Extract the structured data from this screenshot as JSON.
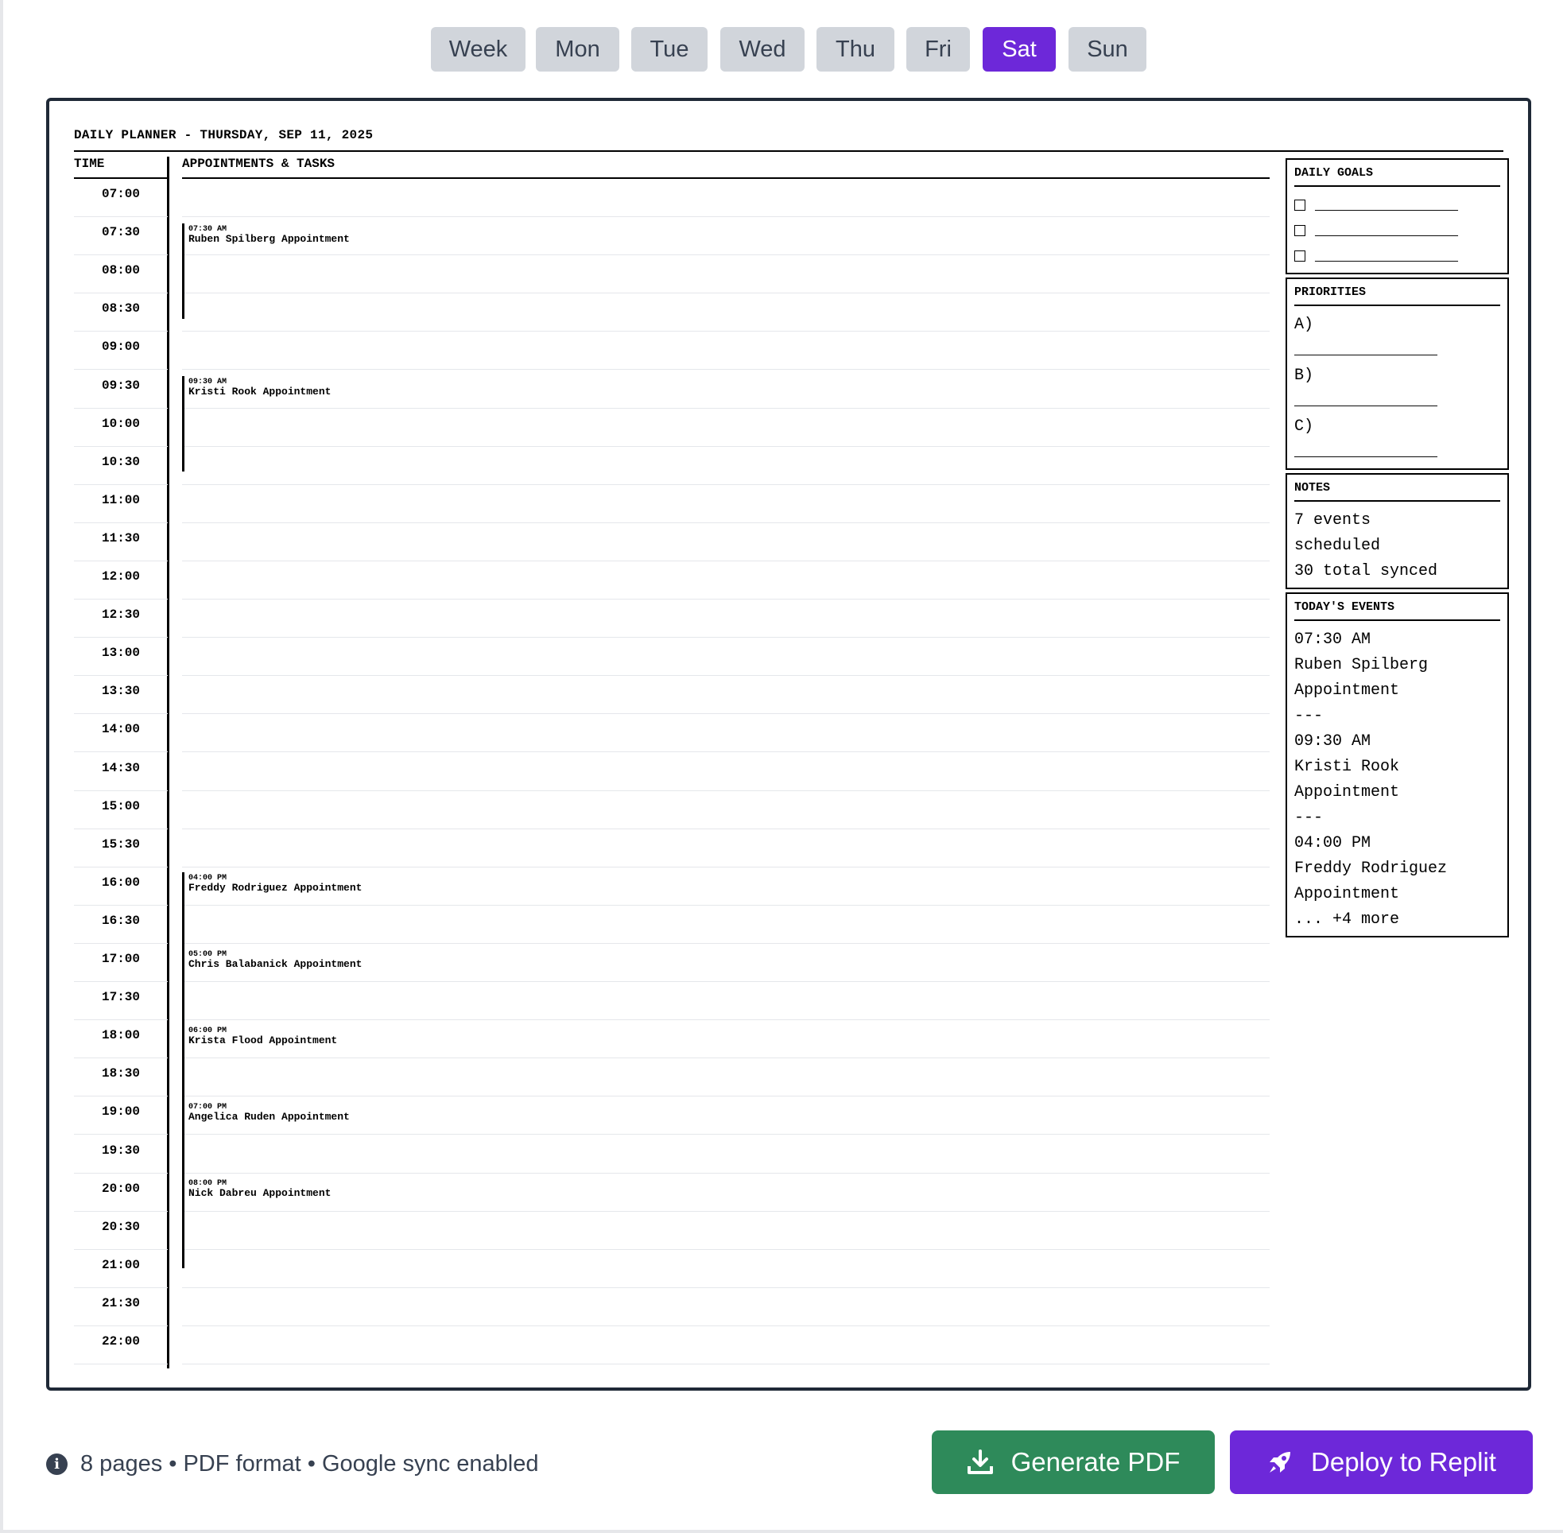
{
  "tabs": [
    {
      "label": "Week",
      "active": false
    },
    {
      "label": "Mon",
      "active": false
    },
    {
      "label": "Tue",
      "active": false
    },
    {
      "label": "Wed",
      "active": false
    },
    {
      "label": "Thu",
      "active": false
    },
    {
      "label": "Fri",
      "active": false
    },
    {
      "label": "Sat",
      "active": true
    },
    {
      "label": "Sun",
      "active": false
    }
  ],
  "planner": {
    "title": "DAILY PLANNER - THURSDAY, SEP 11, 2025",
    "time_header": "TIME",
    "appointments_header": "APPOINTMENTS & TASKS",
    "times": [
      "07:00",
      "07:30",
      "08:00",
      "08:30",
      "09:00",
      "09:30",
      "10:00",
      "10:30",
      "11:00",
      "11:30",
      "12:00",
      "12:30",
      "13:00",
      "13:30",
      "14:00",
      "14:30",
      "15:00",
      "15:30",
      "16:00",
      "16:30",
      "17:00",
      "17:30",
      "18:00",
      "18:30",
      "19:00",
      "19:30",
      "20:00",
      "20:30",
      "21:00",
      "21:30",
      "22:00"
    ],
    "events": [
      {
        "time": "07:30 AM",
        "title": "Ruben Spilberg Appointment"
      },
      {
        "time": "09:30 AM",
        "title": "Kristi Rook Appointment"
      },
      {
        "time": "04:00 PM",
        "title": "Freddy Rodriguez Appointment"
      },
      {
        "time": "05:00 PM",
        "title": "Chris Balabanick Appointment"
      },
      {
        "time": "06:00 PM",
        "title": "Krista Flood Appointment"
      },
      {
        "time": "07:00 PM",
        "title": "Angelica Ruden Appointment"
      },
      {
        "time": "08:00 PM",
        "title": "Nick Dabreu Appointment"
      }
    ]
  },
  "daily_goals": {
    "title": "DAILY GOALS",
    "items": [
      "_______________",
      "_______________",
      "_______________"
    ]
  },
  "priorities": {
    "title": "PRIORITIES",
    "lines": [
      "A)",
      "_______________",
      "B)",
      "_______________",
      "C)",
      "_______________"
    ]
  },
  "notes": {
    "title": "NOTES",
    "lines": [
      "7 events",
      "scheduled",
      "30 total synced"
    ]
  },
  "todays_events": {
    "title": "TODAY'S EVENTS",
    "lines": [
      "07:30 AM",
      "Ruben Spilberg",
      "Appointment",
      "---",
      "09:30 AM",
      "Kristi Rook",
      "Appointment",
      "---",
      "04:00 PM",
      "Freddy Rodriguez",
      "Appointment",
      "... +4 more"
    ]
  },
  "footer": {
    "info_text": "8 pages • PDF format • Google sync enabled",
    "generate_pdf_label": "Generate PDF",
    "deploy_label": "Deploy to Replit"
  },
  "colors": {
    "accent": "#6d28d9",
    "success": "#2e8a5a",
    "tab_inactive": "#d1d5db"
  },
  "icons": {
    "info": "info-icon",
    "download": "download-icon",
    "rocket": "rocket-icon"
  }
}
